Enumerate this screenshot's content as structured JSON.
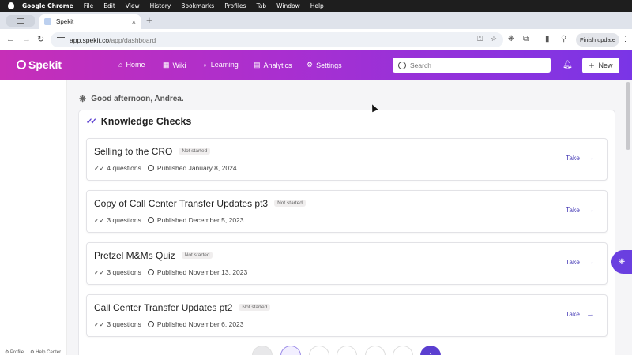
{
  "menubar": {
    "app": "Google Chrome",
    "items": [
      "File",
      "Edit",
      "View",
      "History",
      "Bookmarks",
      "Profiles",
      "Tab",
      "Window",
      "Help"
    ]
  },
  "browser": {
    "tab_title": "Spekit",
    "tab_close": "×",
    "new_tab": "+",
    "url_host": "app.spekit.co",
    "url_path": "/app/dashboard",
    "finish_update": "Finish update"
  },
  "app": {
    "logo": "Spekit",
    "nav": [
      {
        "label": "Home",
        "icon": "home-icon"
      },
      {
        "label": "Wiki",
        "icon": "grid-icon"
      },
      {
        "label": "Learning",
        "icon": "bulb-icon"
      },
      {
        "label": "Analytics",
        "icon": "chart-icon"
      },
      {
        "label": "Settings",
        "icon": "gear-icon"
      }
    ],
    "search_placeholder": "Search",
    "new_label": "New",
    "accent": "#5b3fd0",
    "header_gradient": [
      "#c62fb8",
      "#7a35e6"
    ]
  },
  "sidebar": {
    "footer": [
      "Profile",
      "Help Center"
    ]
  },
  "greeting": "Good afternoon, Andrea.",
  "knowledge_checks": {
    "title": "Knowledge Checks",
    "take_label": "Take",
    "items": [
      {
        "title": "Selling to the CRO",
        "status": "Not started",
        "questions": "4 questions",
        "published": "Published January 8, 2024"
      },
      {
        "title": "Copy of Call Center Transfer Updates pt3",
        "status": "Not started",
        "questions": "3 questions",
        "published": "Published December 5, 2023"
      },
      {
        "title": "Pretzel M&Ms Quiz",
        "status": "Not started",
        "questions": "3 questions",
        "published": "Published November 13, 2023"
      },
      {
        "title": "Call Center Transfer Updates pt2",
        "status": "Not started",
        "questions": "3 questions",
        "published": "Published November 6, 2023"
      }
    ]
  }
}
